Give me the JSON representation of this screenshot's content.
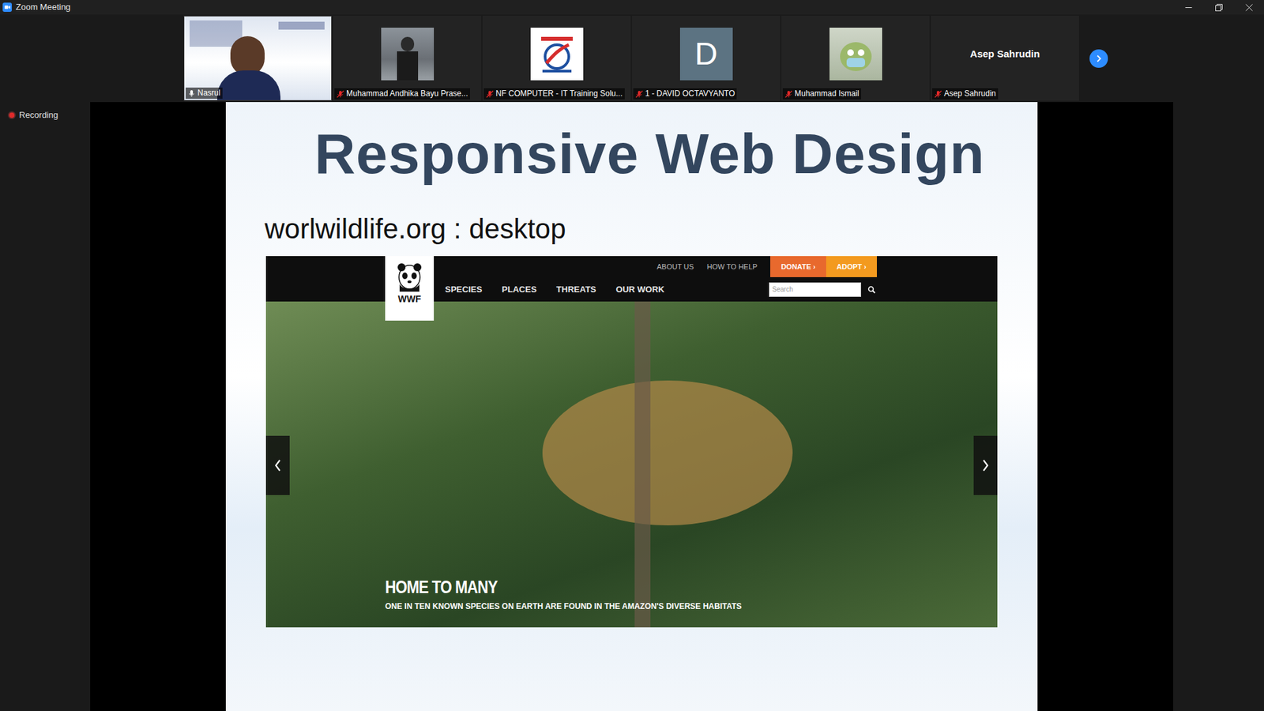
{
  "window": {
    "title": "Zoom Meeting"
  },
  "recording": {
    "label": "Recording"
  },
  "participants": [
    {
      "name": "Nasrul",
      "kind": "video",
      "muted": false
    },
    {
      "name": "Muhammad Andhika Bayu Prase...",
      "kind": "photo",
      "muted": true
    },
    {
      "name": "NF COMPUTER - IT Training Solu...",
      "kind": "logo",
      "muted": true
    },
    {
      "name": "1 - DAVID OCTAVYANTO",
      "kind": "letter",
      "initial": "D",
      "muted": true
    },
    {
      "name": "Muhammad Ismail",
      "kind": "avatar",
      "muted": true
    },
    {
      "name": "Asep Sahrudin",
      "kind": "name",
      "center_text": "Asep Sahrudin",
      "muted": true
    }
  ],
  "slide": {
    "title": "Responsive Web Design",
    "subtitle": "worlwildlife.org : desktop",
    "website": {
      "logo": "WWF",
      "top_nav": [
        {
          "label": "ABOUT US",
          "kind": "link"
        },
        {
          "label": "HOW TO HELP",
          "kind": "link"
        },
        {
          "label": "DONATE ›",
          "kind": "button",
          "color": "#e8692d"
        },
        {
          "label": "ADOPT ›",
          "kind": "button",
          "color": "#f39a1f"
        }
      ],
      "main_nav": [
        "SPECIES",
        "PLACES",
        "THREATS",
        "OUR WORK"
      ],
      "search_placeholder": "Search",
      "hero_title": "HOME TO MANY",
      "hero_caption": "ONE IN TEN KNOWN SPECIES ON EARTH ARE FOUND IN THE AMAZON'S DIVERSE HABITATS"
    }
  }
}
